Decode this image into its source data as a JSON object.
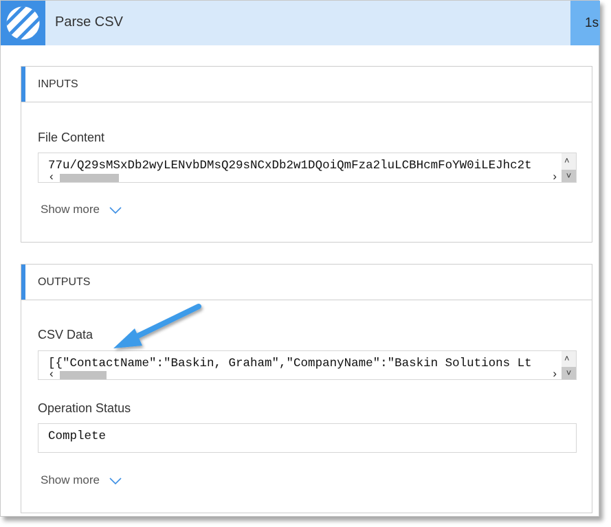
{
  "header": {
    "title": "Parse CSV",
    "duration": "1s"
  },
  "inputs": {
    "section_title": "INPUTS",
    "file_content_label": "File Content",
    "file_content_value": "77u/Q29sMSxDb2wyLENvbDMsQ29sNCxDb2w1DQoiQmFza2luLCBHcmFoYW0iLEJhc2t",
    "show_more": "Show more"
  },
  "outputs": {
    "section_title": "OUTPUTS",
    "csv_data_label": "CSV Data",
    "csv_data_value": "[{\"ContactName\":\"Baskin, Graham\",\"CompanyName\":\"Baskin Solutions Lt",
    "operation_status_label": "Operation Status",
    "operation_status_value": "Complete",
    "show_more": "Show more"
  },
  "colors": {
    "accent": "#3d8fe4",
    "header_bg": "#d8e9fa",
    "duration_bg": "#6db3f2",
    "annotation_arrow": "#3d9be9"
  }
}
